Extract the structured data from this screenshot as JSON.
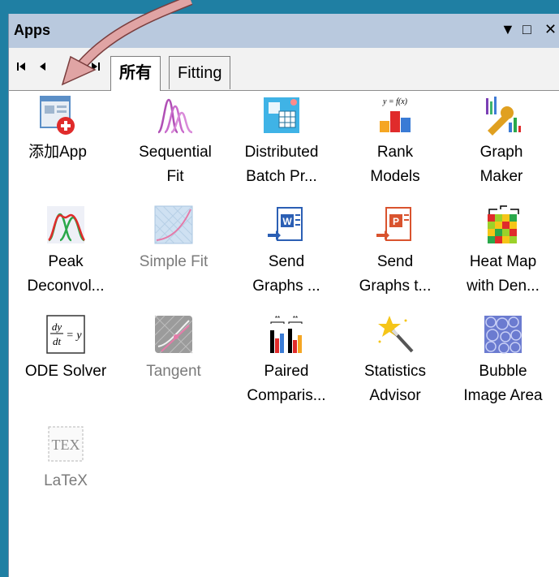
{
  "window": {
    "title": "Apps",
    "controls": {
      "menu": "▼",
      "maximize": "□",
      "close": "✕"
    }
  },
  "tabs": [
    {
      "label": "所有"
    },
    {
      "label": "Fitting"
    }
  ],
  "apps": [
    {
      "label_line1": "添加App",
      "label_line2": "",
      "icon": "add-app-icon"
    },
    {
      "label_line1": "Sequential",
      "label_line2": "Fit",
      "icon": "sequential-fit-icon"
    },
    {
      "label_line1": "Distributed",
      "label_line2": "Batch Pr...",
      "icon": "distributed-batch-icon"
    },
    {
      "label_line1": "Rank",
      "label_line2": "Models",
      "icon": "rank-models-icon",
      "icon_text": "y = f(x)"
    },
    {
      "label_line1": "Graph",
      "label_line2": "Maker",
      "icon": "graph-maker-icon"
    },
    {
      "label_line1": "Peak",
      "label_line2": "Deconvol...",
      "icon": "peak-deconvolution-icon"
    },
    {
      "label_line1": "Simple Fit",
      "label_line2": "",
      "icon": "simple-fit-icon"
    },
    {
      "label_line1": "Send",
      "label_line2": "Graphs ...",
      "icon": "send-graphs-word-icon"
    },
    {
      "label_line1": "Send",
      "label_line2": "Graphs t...",
      "icon": "send-graphs-ppt-icon"
    },
    {
      "label_line1": "Heat Map",
      "label_line2": "with Den...",
      "icon": "heat-map-icon"
    },
    {
      "label_line1": "ODE Solver",
      "label_line2": "",
      "icon": "ode-solver-icon"
    },
    {
      "label_line1": "Tangent",
      "label_line2": "",
      "icon": "tangent-icon"
    },
    {
      "label_line1": "Paired",
      "label_line2": "Comparis...",
      "icon": "paired-comparison-icon"
    },
    {
      "label_line1": "Statistics",
      "label_line2": "Advisor",
      "icon": "statistics-advisor-icon"
    },
    {
      "label_line1": "Bubble",
      "label_line2": "Image Area",
      "icon": "bubble-image-icon"
    },
    {
      "label_line1": "LaTeX",
      "label_line2": "",
      "icon": "latex-icon"
    }
  ]
}
